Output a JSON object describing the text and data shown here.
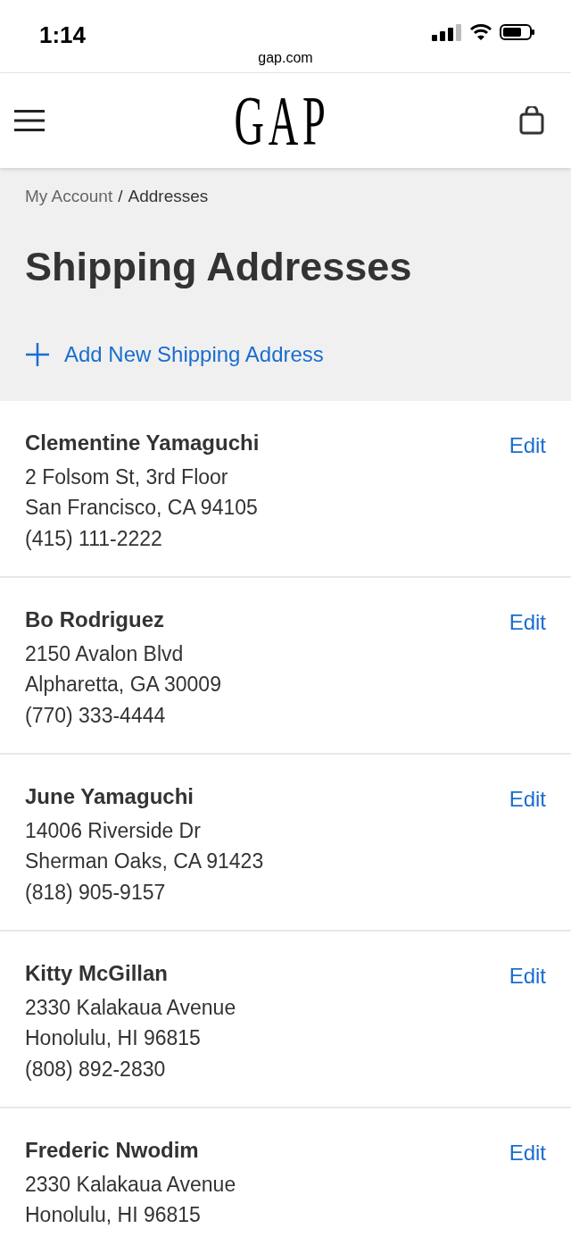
{
  "status_bar": {
    "time": "1:14",
    "url": "gap.com"
  },
  "header": {
    "logo": "GAP"
  },
  "breadcrumb": {
    "items": [
      {
        "label": "My Account"
      },
      {
        "label": "Addresses"
      }
    ],
    "separator": "/"
  },
  "title": "Shipping Addresses",
  "add_link": "Add New Shipping Address",
  "addresses": [
    {
      "name": "Clementine Yamaguchi",
      "lines": [
        "2 Folsom St, 3rd Floor",
        "San Francisco, CA 94105",
        "(415) 111-2222"
      ],
      "action": "Edit"
    },
    {
      "name": "Bo Rodriguez",
      "lines": [
        "2150 Avalon Blvd",
        "Alpharetta, GA 30009",
        "(770) 333-4444"
      ],
      "action": "Edit"
    },
    {
      "name": "June Yamaguchi",
      "lines": [
        "14006 Riverside Dr",
        "Sherman Oaks, CA 91423",
        "(818) 905-9157"
      ],
      "action": "Edit"
    },
    {
      "name": "Kitty McGillan",
      "lines": [
        "2330 Kalakaua Avenue",
        "Honolulu, HI 96815",
        "(808) 892-2830"
      ],
      "action": "Edit"
    },
    {
      "name": "Frederic Nwodim",
      "lines": [
        "2330 Kalakaua Avenue",
        "Honolulu, HI 96815"
      ],
      "action": "Edit"
    }
  ]
}
